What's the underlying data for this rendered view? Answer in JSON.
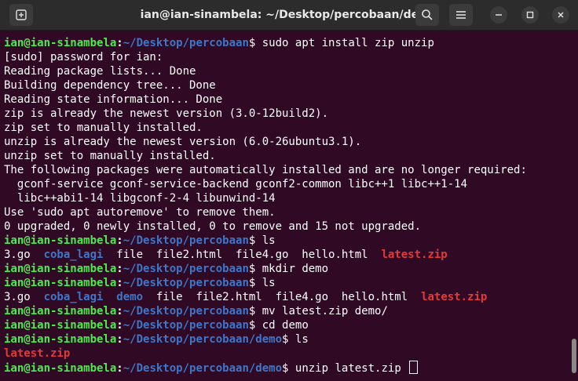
{
  "window": {
    "title": "ian@ian-sinambela: ~/Desktop/percobaan/demo"
  },
  "titlebar": {
    "new_tab_icon": "new-tab-icon",
    "search_icon": "search-icon",
    "menu_icon": "hamburger-menu-icon"
  },
  "colors": {
    "background": "#300a24",
    "user": "#4ee94e",
    "path": "#3f76c8",
    "zip": "#e23a3a",
    "text": "#ffffff"
  },
  "terminal": {
    "lines": [
      {
        "segments": [
          {
            "t": "ian@ian-sinambela",
            "c": "u"
          },
          {
            "t": ":",
            "c": "p"
          },
          {
            "t": "~/Desktop/percobaan",
            "c": "d"
          },
          {
            "t": "$ sudo apt install zip unzip",
            "c": ""
          }
        ]
      },
      {
        "segments": [
          {
            "t": "[sudo] password for ian:",
            "c": ""
          }
        ]
      },
      {
        "segments": [
          {
            "t": "Reading package lists... Done",
            "c": ""
          }
        ]
      },
      {
        "segments": [
          {
            "t": "Building dependency tree... Done",
            "c": ""
          }
        ]
      },
      {
        "segments": [
          {
            "t": "Reading state information... Done",
            "c": ""
          }
        ]
      },
      {
        "segments": [
          {
            "t": "zip is already the newest version (3.0-12build2).",
            "c": ""
          }
        ]
      },
      {
        "segments": [
          {
            "t": "zip set to manually installed.",
            "c": ""
          }
        ]
      },
      {
        "segments": [
          {
            "t": "unzip is already the newest version (6.0-26ubuntu3.1).",
            "c": ""
          }
        ]
      },
      {
        "segments": [
          {
            "t": "unzip set to manually installed.",
            "c": ""
          }
        ]
      },
      {
        "segments": [
          {
            "t": "The following packages were automatically installed and are no longer required:",
            "c": ""
          }
        ]
      },
      {
        "segments": [
          {
            "t": "  gconf-service gconf-service-backend gconf2-common libc++1 libc++1-14",
            "c": ""
          }
        ]
      },
      {
        "segments": [
          {
            "t": "  libc++abi1-14 libgconf-2-4 libunwind-14",
            "c": ""
          }
        ]
      },
      {
        "segments": [
          {
            "t": "Use 'sudo apt autoremove' to remove them.",
            "c": ""
          }
        ]
      },
      {
        "segments": [
          {
            "t": "0 upgraded, 0 newly installed, 0 to remove and 15 not upgraded.",
            "c": ""
          }
        ]
      },
      {
        "segments": [
          {
            "t": "ian@ian-sinambela",
            "c": "u"
          },
          {
            "t": ":",
            "c": "p"
          },
          {
            "t": "~/Desktop/percobaan",
            "c": "d"
          },
          {
            "t": "$ ls",
            "c": ""
          }
        ]
      },
      {
        "segments": [
          {
            "t": "3.go  ",
            "c": ""
          },
          {
            "t": "coba_lagi",
            "c": "d"
          },
          {
            "t": "  file  file2.html  file4.go  hello.html  ",
            "c": ""
          },
          {
            "t": "latest.zip",
            "c": "z"
          }
        ]
      },
      {
        "segments": [
          {
            "t": "ian@ian-sinambela",
            "c": "u"
          },
          {
            "t": ":",
            "c": "p"
          },
          {
            "t": "~/Desktop/percobaan",
            "c": "d"
          },
          {
            "t": "$ mkdir demo",
            "c": ""
          }
        ]
      },
      {
        "segments": [
          {
            "t": "ian@ian-sinambela",
            "c": "u"
          },
          {
            "t": ":",
            "c": "p"
          },
          {
            "t": "~/Desktop/percobaan",
            "c": "d"
          },
          {
            "t": "$ ls",
            "c": ""
          }
        ]
      },
      {
        "segments": [
          {
            "t": "3.go  ",
            "c": ""
          },
          {
            "t": "coba_lagi",
            "c": "d"
          },
          {
            "t": "  ",
            "c": ""
          },
          {
            "t": "demo",
            "c": "d"
          },
          {
            "t": "  file  file2.html  file4.go  hello.html  ",
            "c": ""
          },
          {
            "t": "latest.zip",
            "c": "z"
          }
        ]
      },
      {
        "segments": [
          {
            "t": "ian@ian-sinambela",
            "c": "u"
          },
          {
            "t": ":",
            "c": "p"
          },
          {
            "t": "~/Desktop/percobaan",
            "c": "d"
          },
          {
            "t": "$ mv latest.zip demo/",
            "c": ""
          }
        ]
      },
      {
        "segments": [
          {
            "t": "ian@ian-sinambela",
            "c": "u"
          },
          {
            "t": ":",
            "c": "p"
          },
          {
            "t": "~/Desktop/percobaan",
            "c": "d"
          },
          {
            "t": "$ cd demo",
            "c": ""
          }
        ]
      },
      {
        "segments": [
          {
            "t": "ian@ian-sinambela",
            "c": "u"
          },
          {
            "t": ":",
            "c": "p"
          },
          {
            "t": "~/Desktop/percobaan/demo",
            "c": "d"
          },
          {
            "t": "$ ls",
            "c": ""
          }
        ]
      },
      {
        "segments": [
          {
            "t": "latest.zip",
            "c": "z"
          }
        ]
      },
      {
        "segments": [
          {
            "t": "ian@ian-sinambela",
            "c": "u"
          },
          {
            "t": ":",
            "c": "p"
          },
          {
            "t": "~/Desktop/percobaan/demo",
            "c": "d"
          },
          {
            "t": "$ unzip latest.zip ",
            "c": ""
          }
        ],
        "cursor": true
      }
    ]
  }
}
